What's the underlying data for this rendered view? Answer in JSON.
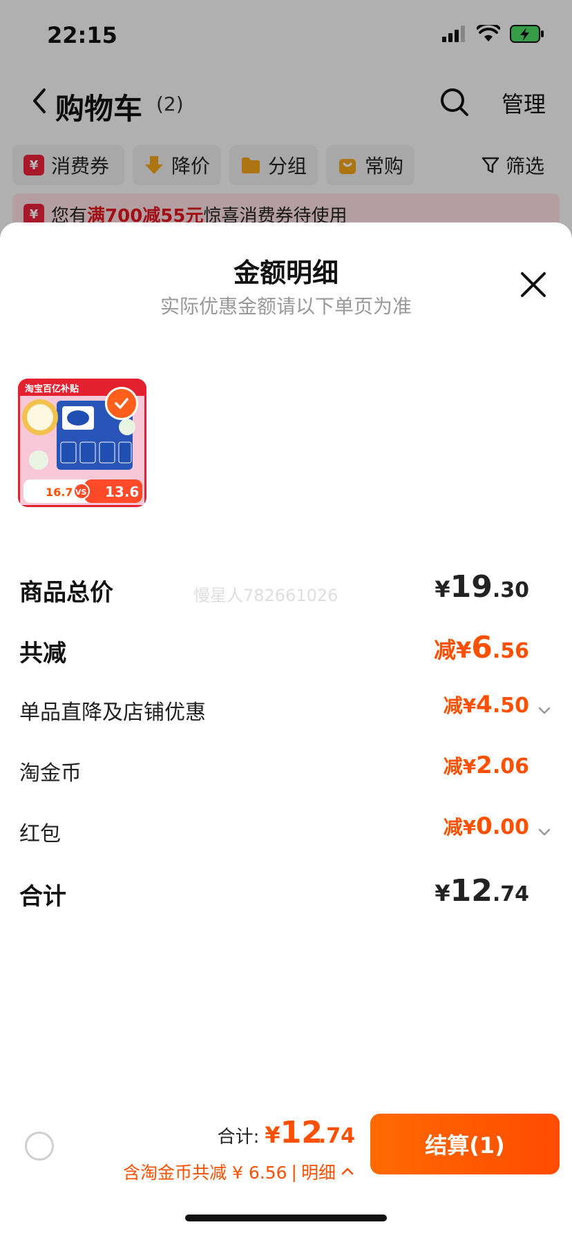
{
  "status_bar": {
    "time": "22:15"
  },
  "nav": {
    "title": "购物车",
    "count": "(2)",
    "manage": "管理"
  },
  "filters": [
    {
      "label": "消费券",
      "icon": "yen-coupon-icon",
      "icon_color": "#e8233a"
    },
    {
      "label": "降价",
      "icon": "price-drop-icon",
      "icon_color": "#f0a21a"
    },
    {
      "label": "分组",
      "icon": "folder-icon",
      "icon_color": "#f0a21a"
    },
    {
      "label": "常购",
      "icon": "bag-icon",
      "icon_color": "#f0a21a"
    }
  ],
  "filter_plain": {
    "label": "筛选",
    "icon": "funnel-icon"
  },
  "coupon_banner": {
    "prefix": "您有",
    "highlight": "满700减55元",
    "suffix": "惊喜消费券待使用"
  },
  "sheet": {
    "title": "金额明细",
    "subtitle": "实际优惠金额请以下单页为准",
    "watermark": "慢星人782661026",
    "product": {
      "badge_top": "淘宝百亿补贴",
      "badge_left": "16.7",
      "badge_vs": "VS",
      "badge_right": "13.6",
      "selected": true
    },
    "rows": [
      {
        "label": "商品总价",
        "value_prefix": "¥",
        "value_int": "19",
        "value_dec": ".30",
        "style": "dark-big",
        "chevron": false
      },
      {
        "label": "共减",
        "value_prefix": "减¥",
        "value_int": "6",
        "value_dec": ".56",
        "style": "orange-big",
        "chevron": false
      },
      {
        "label": "单品直降及店铺优惠",
        "value_prefix": "减¥",
        "value_int": "4",
        "value_dec": ".50",
        "style": "orange-small",
        "chevron": true
      },
      {
        "label": "淘金币",
        "value_prefix": "减¥",
        "value_int": "2",
        "value_dec": ".06",
        "style": "orange-small",
        "chevron": false
      },
      {
        "label": "红包",
        "value_prefix": "减¥",
        "value_int": "0",
        "value_dec": ".00",
        "style": "orange-small",
        "chevron": true
      },
      {
        "label": "合计",
        "value_prefix": "¥",
        "value_int": "12",
        "value_dec": ".74",
        "style": "dark-big",
        "chevron": false
      }
    ]
  },
  "footer": {
    "total_label": "合计:",
    "total_yen": "¥",
    "total_int": "12",
    "total_dec": ".74",
    "discount_text": "含淘金币共减 ¥ 6.56",
    "detail_link": "明细",
    "checkout_label": "结算(1)"
  },
  "colors": {
    "accent": "#ff5000",
    "coupon_red": "#e0141e"
  }
}
